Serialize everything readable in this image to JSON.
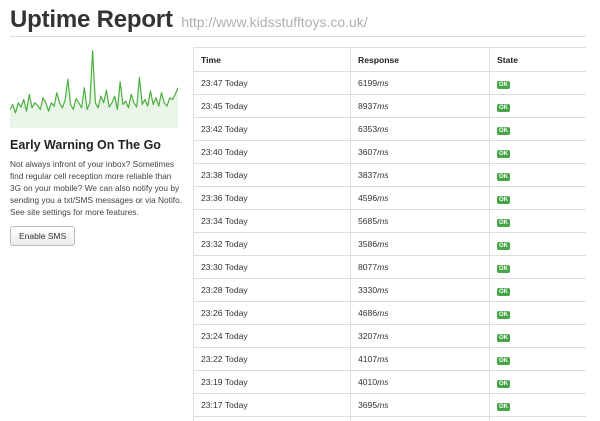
{
  "header": {
    "title": "Uptime Report",
    "url": "http://www.kidsstufftoys.co.uk/"
  },
  "sidebar": {
    "heading": "Early Warning On The Go",
    "body": "Not always infront of your inbox? Sometimes find regular cell reception more reliable than 3G on your mobile? We can also notify you by sending you a txt/SMS messages or via Notifo. See site settings for more features.",
    "button_label": "Enable SMS"
  },
  "sparkline": {
    "color": "#4cae3f",
    "values": [
      22,
      28,
      18,
      30,
      25,
      34,
      20,
      40,
      24,
      30,
      27,
      22,
      36,
      30,
      20,
      30,
      26,
      42,
      30,
      24,
      33,
      58,
      28,
      22,
      35,
      30,
      24,
      48,
      22,
      30,
      92,
      30,
      24,
      38,
      30,
      45,
      25,
      30,
      38,
      22,
      55,
      28,
      32,
      24,
      40,
      30,
      25,
      60,
      28,
      34,
      26,
      44,
      28,
      36,
      26,
      42,
      30,
      26,
      36,
      34,
      40,
      48
    ]
  },
  "table": {
    "columns": [
      "Time",
      "Response",
      "State"
    ],
    "unit": "ms",
    "rows": [
      {
        "time": "23:47 Today",
        "response": "6199",
        "state": "OK"
      },
      {
        "time": "23:45 Today",
        "response": "8937",
        "state": "OK"
      },
      {
        "time": "23:42 Today",
        "response": "6353",
        "state": "OK"
      },
      {
        "time": "23:40 Today",
        "response": "3607",
        "state": "OK"
      },
      {
        "time": "23:38 Today",
        "response": "3837",
        "state": "OK"
      },
      {
        "time": "23:36 Today",
        "response": "4596",
        "state": "OK"
      },
      {
        "time": "23:34 Today",
        "response": "5685",
        "state": "OK"
      },
      {
        "time": "23:32 Today",
        "response": "3586",
        "state": "OK"
      },
      {
        "time": "23:30 Today",
        "response": "8077",
        "state": "OK"
      },
      {
        "time": "23:28 Today",
        "response": "3330",
        "state": "OK"
      },
      {
        "time": "23:26 Today",
        "response": "4686",
        "state": "OK"
      },
      {
        "time": "23:24 Today",
        "response": "3207",
        "state": "OK"
      },
      {
        "time": "23:22 Today",
        "response": "4107",
        "state": "OK"
      },
      {
        "time": "23:19 Today",
        "response": "4010",
        "state": "OK"
      },
      {
        "time": "23:17 Today",
        "response": "3695",
        "state": "OK"
      },
      {
        "time": "",
        "response": "",
        "state": ""
      }
    ]
  }
}
